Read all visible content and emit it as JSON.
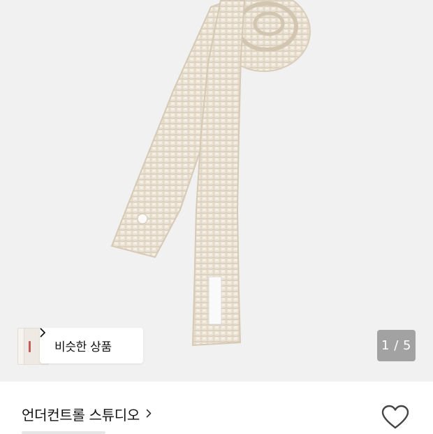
{
  "product_image": {
    "alt_subject": "knit-tie",
    "background_color": "#f1f1f1",
    "knit_color": "#ece3d5"
  },
  "similar_products": {
    "label": "비슷한 상품",
    "icon": "chevron-right-icon"
  },
  "gallery": {
    "counter": "1 / 5",
    "current": 1,
    "total": 5
  },
  "brand": {
    "name": "언더컨트롤 스튜디오",
    "icon": "chevron-right-icon"
  },
  "wishlist": {
    "icon": "heart-icon"
  }
}
